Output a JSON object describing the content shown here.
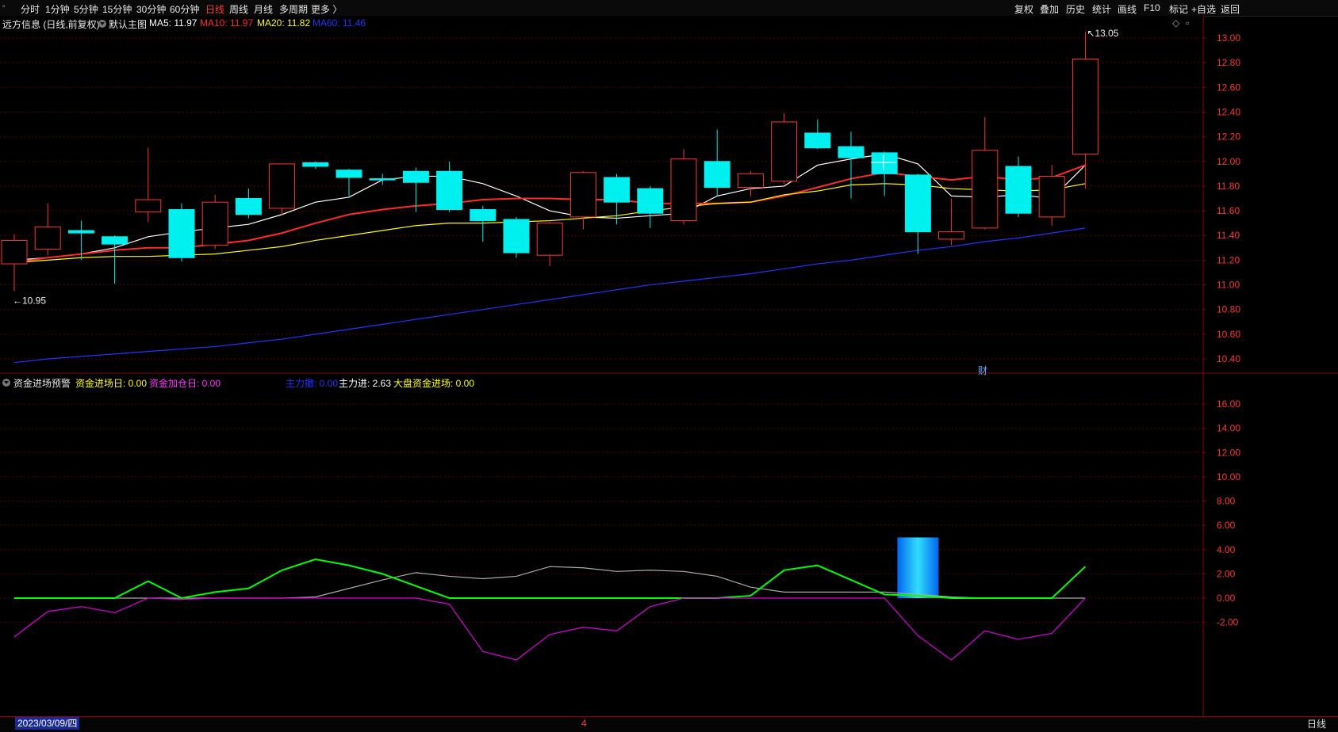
{
  "toolbar": {
    "tabs": [
      "分时",
      "1分钟",
      "5分钟",
      "15分钟",
      "30分钟",
      "60分钟",
      "日线",
      "周线",
      "月线",
      "多周期",
      "更多 〉"
    ],
    "active_tab": "日线",
    "right_tools": [
      "复权",
      "叠加",
      "历史",
      "统计",
      "画线",
      "F10",
      "标记",
      "+自选",
      "返回"
    ]
  },
  "main_panel": {
    "stock_title": "远方信息 (日线,前复权)",
    "template": "默认主图",
    "ma_labels": [
      {
        "text": "MA5: 11.97",
        "color": "#ffffff"
      },
      {
        "text": "MA10: 11.97",
        "color": "#ff2a2a"
      },
      {
        "text": "MA20: 11.82",
        "color": "#ffff00"
      },
      {
        "text": "MA60: 11.46",
        "color": "#2233ff"
      }
    ],
    "high_marker": "13.05",
    "low_marker": "10.95",
    "finance_marker": "财"
  },
  "sub_panel": {
    "indicator_name": "资金进场预警",
    "labels": [
      {
        "text": "资金进场日: 0.00",
        "color": "#ffff00"
      },
      {
        "text": "资金加仓日: 0.00",
        "color": "#ff33ff"
      },
      {
        "text": "主力撤: 0.00",
        "color": "#2233ff"
      },
      {
        "text": "主力进: 2.63",
        "color": "#ffffff"
      },
      {
        "text": "大盘资金进场: 0.00",
        "color": "#ffff00"
      }
    ]
  },
  "bottom": {
    "date": "2023/03/09/四",
    "month_tick": "4",
    "period": "日线"
  },
  "colors": {
    "up": "#ff3333",
    "down": "#00f0f0",
    "grid": "#5a0000",
    "axis": "#8b0000"
  },
  "chart_data": [
    {
      "type": "candlestick",
      "ylim": [
        10.4,
        13.1
      ],
      "yticks": [
        "13.00",
        "12.80",
        "12.60",
        "12.40",
        "12.20",
        "12.00",
        "11.80",
        "11.60",
        "11.40",
        "11.20",
        "11.00",
        "10.80",
        "10.60",
        "10.40"
      ],
      "candles": [
        {
          "o": 11.17,
          "h": 11.41,
          "l": 10.95,
          "c": 11.36
        },
        {
          "o": 11.29,
          "h": 11.66,
          "l": 11.24,
          "c": 11.47
        },
        {
          "o": 11.44,
          "h": 11.52,
          "l": 11.2,
          "c": 11.42
        },
        {
          "o": 11.39,
          "h": 11.4,
          "l": 11.01,
          "c": 11.33
        },
        {
          "o": 11.59,
          "h": 12.11,
          "l": 11.51,
          "c": 11.69
        },
        {
          "o": 11.61,
          "h": 11.66,
          "l": 11.19,
          "c": 11.22
        },
        {
          "o": 11.32,
          "h": 11.73,
          "l": 11.29,
          "c": 11.67
        },
        {
          "o": 11.7,
          "h": 11.78,
          "l": 11.54,
          "c": 11.57
        },
        {
          "o": 11.62,
          "h": 11.98,
          "l": 11.57,
          "c": 11.98
        },
        {
          "o": 11.99,
          "h": 12.0,
          "l": 11.94,
          "c": 11.96
        },
        {
          "o": 11.93,
          "h": 11.94,
          "l": 11.72,
          "c": 11.87
        },
        {
          "o": 11.86,
          "h": 11.9,
          "l": 11.81,
          "c": 11.85
        },
        {
          "o": 11.92,
          "h": 11.95,
          "l": 11.59,
          "c": 11.83
        },
        {
          "o": 11.92,
          "h": 12.0,
          "l": 11.59,
          "c": 11.61
        },
        {
          "o": 11.61,
          "h": 11.64,
          "l": 11.35,
          "c": 11.52
        },
        {
          "o": 11.53,
          "h": 11.55,
          "l": 11.22,
          "c": 11.26
        },
        {
          "o": 11.24,
          "h": 11.51,
          "l": 11.15,
          "c": 11.5
        },
        {
          "o": 11.55,
          "h": 11.92,
          "l": 11.45,
          "c": 11.91
        },
        {
          "o": 11.87,
          "h": 11.9,
          "l": 11.49,
          "c": 11.67
        },
        {
          "o": 11.78,
          "h": 11.8,
          "l": 11.46,
          "c": 11.58
        },
        {
          "o": 11.52,
          "h": 12.1,
          "l": 11.49,
          "c": 12.02
        },
        {
          "o": 12.0,
          "h": 12.26,
          "l": 11.72,
          "c": 11.79
        },
        {
          "o": 11.79,
          "h": 11.92,
          "l": 11.72,
          "c": 11.9
        },
        {
          "o": 11.84,
          "h": 12.39,
          "l": 11.82,
          "c": 12.32
        },
        {
          "o": 12.23,
          "h": 12.34,
          "l": 12.1,
          "c": 12.11
        },
        {
          "o": 12.12,
          "h": 12.24,
          "l": 11.7,
          "c": 12.03
        },
        {
          "o": 12.07,
          "h": 12.08,
          "l": 11.72,
          "c": 11.9
        },
        {
          "o": 11.89,
          "h": 11.9,
          "l": 11.25,
          "c": 11.43
        },
        {
          "o": 11.37,
          "h": 11.7,
          "l": 11.32,
          "c": 11.43
        },
        {
          "o": 11.46,
          "h": 12.36,
          "l": 11.45,
          "c": 12.09
        },
        {
          "o": 11.96,
          "h": 12.04,
          "l": 11.55,
          "c": 11.58
        },
        {
          "o": 11.55,
          "h": 11.97,
          "l": 11.48,
          "c": 11.88
        },
        {
          "o": 12.06,
          "h": 13.05,
          "l": 11.78,
          "c": 12.83
        }
      ],
      "series": [
        {
          "name": "MA5",
          "color": "#ffffff",
          "values": [
            11.2,
            11.22,
            11.25,
            11.3,
            11.39,
            11.43,
            11.46,
            11.49,
            11.57,
            11.67,
            11.71,
            11.85,
            11.88,
            11.88,
            11.82,
            11.72,
            11.6,
            11.55,
            11.54,
            11.56,
            11.58,
            11.72,
            11.78,
            11.8,
            11.97,
            12.02,
            12.06,
            11.98,
            11.72,
            11.71,
            11.73,
            11.7,
            11.97
          ]
        },
        {
          "name": "MA10",
          "color": "#ff2a2a",
          "values": [
            11.18,
            11.22,
            11.25,
            11.28,
            11.3,
            11.3,
            11.33,
            11.36,
            11.42,
            11.5,
            11.57,
            11.61,
            11.64,
            11.66,
            11.69,
            11.7,
            11.7,
            11.69,
            11.69,
            11.66,
            11.66,
            11.66,
            11.67,
            11.72,
            11.79,
            11.86,
            11.91,
            11.88,
            11.85,
            11.88,
            11.85,
            11.87,
            11.97
          ]
        },
        {
          "name": "MA20",
          "color": "#ffff00",
          "values": [
            11.18,
            11.2,
            11.22,
            11.23,
            11.23,
            11.24,
            11.25,
            11.28,
            11.31,
            11.36,
            11.4,
            11.44,
            11.48,
            11.5,
            11.5,
            11.51,
            11.52,
            11.54,
            11.56,
            11.6,
            11.63,
            11.66,
            11.67,
            11.73,
            11.76,
            11.81,
            11.82,
            11.81,
            11.78,
            11.77,
            11.76,
            11.77,
            11.82
          ]
        },
        {
          "name": "MA60",
          "color": "#2233ff",
          "values": [
            10.37,
            10.4,
            10.42,
            10.44,
            10.46,
            10.48,
            10.5,
            10.53,
            10.56,
            10.6,
            10.64,
            10.68,
            10.72,
            10.76,
            10.8,
            10.84,
            10.88,
            10.92,
            10.96,
            11.0,
            11.03,
            11.06,
            11.09,
            11.13,
            11.17,
            11.2,
            11.24,
            11.28,
            11.31,
            11.35,
            11.38,
            11.42,
            11.46
          ]
        }
      ]
    },
    {
      "type": "line",
      "ylim": [
        -4.8,
        17.5
      ],
      "yticks": [
        "16.00",
        "14.00",
        "12.00",
        "10.00",
        "8.00",
        "6.00",
        "4.00",
        "2.00",
        "0.00",
        "-2.00"
      ],
      "series": [
        {
          "name": "主力进",
          "color": "#aaaaaa",
          "values": [
            0,
            0,
            0,
            0,
            0,
            0,
            0,
            0,
            0,
            0.1,
            0.8,
            1.5,
            2.1,
            1.8,
            1.6,
            1.8,
            2.6,
            2.5,
            2.2,
            2.3,
            2.2,
            1.8,
            0.9,
            0.5,
            0.5,
            0.5,
            0.5,
            0.3,
            0.1,
            0,
            0,
            0,
            0
          ]
        },
        {
          "name": "资金进场日",
          "color": "#00ff00",
          "values": [
            0,
            0,
            0,
            0,
            1.4,
            0,
            0.5,
            0.8,
            2.3,
            3.2,
            2.7,
            2.0,
            1.0,
            0,
            0,
            0,
            0,
            0,
            0,
            0,
            0,
            0,
            0.2,
            2.3,
            2.7,
            1.5,
            0.3,
            0.2,
            0,
            0,
            0,
            0,
            2.6
          ]
        },
        {
          "name": "资金加仓日",
          "color": "#dd00dd",
          "values": [
            -3.2,
            -1.1,
            -0.7,
            -1.2,
            0,
            -0.1,
            0,
            0,
            0,
            0,
            0,
            0,
            0,
            -0.5,
            -4.4,
            -5.1,
            -3.0,
            -2.4,
            -2.7,
            -0.7,
            0,
            0,
            0,
            0,
            0,
            0,
            0,
            -3.1,
            -5.1,
            -2.7,
            -3.4,
            -2.9,
            0
          ]
        },
        {
          "name": "大盘资金进场",
          "type": "bar",
          "values": [
            0,
            0,
            0,
            0,
            0,
            0,
            0,
            0,
            0,
            0,
            0,
            0,
            0,
            0,
            0,
            0,
            0,
            0,
            0,
            0,
            0,
            0,
            0,
            0,
            0,
            0,
            0,
            5.0,
            0,
            0,
            0,
            0,
            0
          ]
        }
      ]
    }
  ]
}
